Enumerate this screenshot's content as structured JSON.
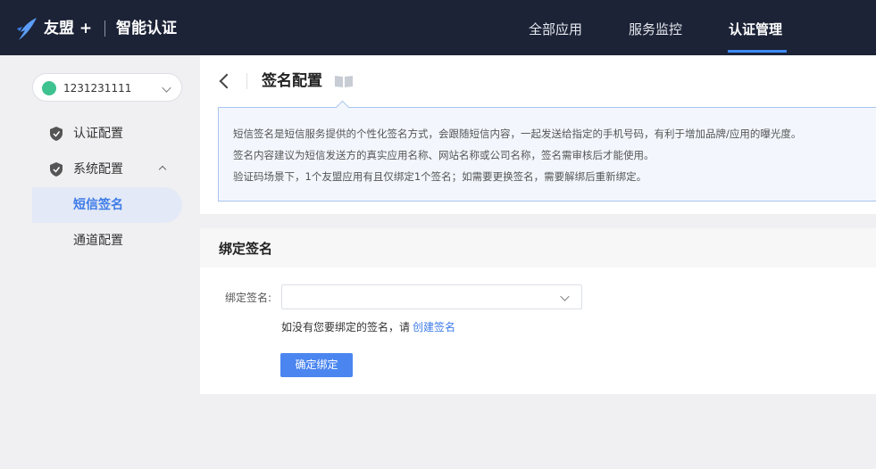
{
  "header": {
    "brand": "友盟 +",
    "product": "智能认证",
    "nav": [
      {
        "label": "全部应用",
        "active": false
      },
      {
        "label": "服务监控",
        "active": false
      },
      {
        "label": "认证管理",
        "active": true
      }
    ],
    "accent": "#3d8af7",
    "bg": "#1c2337"
  },
  "sidebar": {
    "app_select": {
      "value": "1231231111",
      "icon": "android-icon"
    },
    "items": [
      {
        "label": "认证配置",
        "icon": "shield-icon"
      },
      {
        "label": "系统配置",
        "icon": "shield-icon",
        "expanded": true
      },
      {
        "label": "短信签名",
        "active": true
      },
      {
        "label": "通道配置"
      }
    ]
  },
  "page": {
    "title": "签名配置",
    "title_icon": "book-icon",
    "info": [
      "短信签名是短信服务提供的个性化签名方式，会跟随短信内容，一起发送给指定的手机号码，有利于增加品牌/应用的曝光度。",
      "签名内容建议为短信发送方的真实应用名称、网站名称或公司名称，签名需审核后才能使用。",
      "验证码场景下，1个友盟应用有且仅绑定1个签名；如需要更换签名，需要解绑后重新绑定。"
    ]
  },
  "bind": {
    "section_title": "绑定签名",
    "field_label": "绑定签名:",
    "select_value": "",
    "hint": "如没有您要绑定的签名，请",
    "hint_link": "创建签名",
    "submit": "确定绑定",
    "button_color": "#4b86f0"
  }
}
